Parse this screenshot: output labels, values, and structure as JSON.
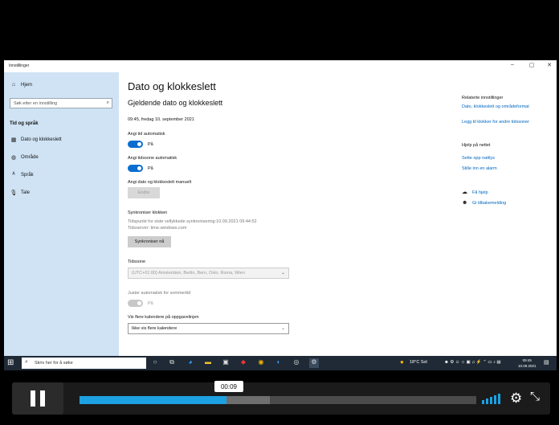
{
  "window": {
    "title": "Innstillinger",
    "controls": [
      "–",
      "▢",
      "✕"
    ]
  },
  "sidebar": {
    "home": "Hjem",
    "search_placeholder": "Søk etter en innstilling",
    "category": "Tid og språk",
    "items": [
      {
        "label": "Dato og klokkeslett",
        "icon": "calendar-clock-icon"
      },
      {
        "label": "Område",
        "icon": "globe-icon"
      },
      {
        "label": "Språk",
        "icon": "language-icon"
      },
      {
        "label": "Tale",
        "icon": "microphone-icon"
      }
    ]
  },
  "main": {
    "title": "Dato og klokkeslett",
    "current_heading": "Gjeldende dato og klokkeslett",
    "current_value": "09:45, fredag 10. september 2021",
    "auto_time_label": "Angi tid automatisk",
    "auto_time_state": "På",
    "auto_zone_label": "Angi tidssone automatisk",
    "auto_zone_state": "På",
    "manual_label": "Angi dato og klokkeslett manuelt",
    "manual_button": "Endre",
    "sync_heading": "Synkroniser klokken",
    "sync_last": "Tidspunkt for siste vellykkede synkronisering:10.09.2021 09:44:52",
    "sync_server": "Tidsserver: time.windows.com",
    "sync_button": "Synkroniser nå",
    "timezone_label": "Tidssone",
    "timezone_value": "(UTC+01:00) Amsterdam, Berlin, Bern, Oslo, Roma, Wien",
    "dst_label": "Juster automatisk for sommertid",
    "dst_state": "På",
    "calendars_label": "Vis flere kalendere på oppgavelinjen",
    "calendars_value": "Ikke vis flere kalendere"
  },
  "related": {
    "heading": "Relaterte innstillinger",
    "link1": "Dato, klokkeslett og områdeformat",
    "link2": "Legg til klokker for andre tidssoner",
    "help_heading": "Hjelp på nettet",
    "help_link1": "Sette opp nattlys",
    "help_link2": "Stille inn en alarm",
    "get_help": "Få hjelp",
    "feedback": "Gi tilbakemelding"
  },
  "taskbar": {
    "search_placeholder": "Skriv her for å søke",
    "weather": "18°C  Sol",
    "clock_time": "09:45",
    "clock_date": "10.09.2021"
  },
  "player": {
    "time_tooltip": "00:09",
    "progress_played": 0.37,
    "progress_buffered": 0.48
  }
}
